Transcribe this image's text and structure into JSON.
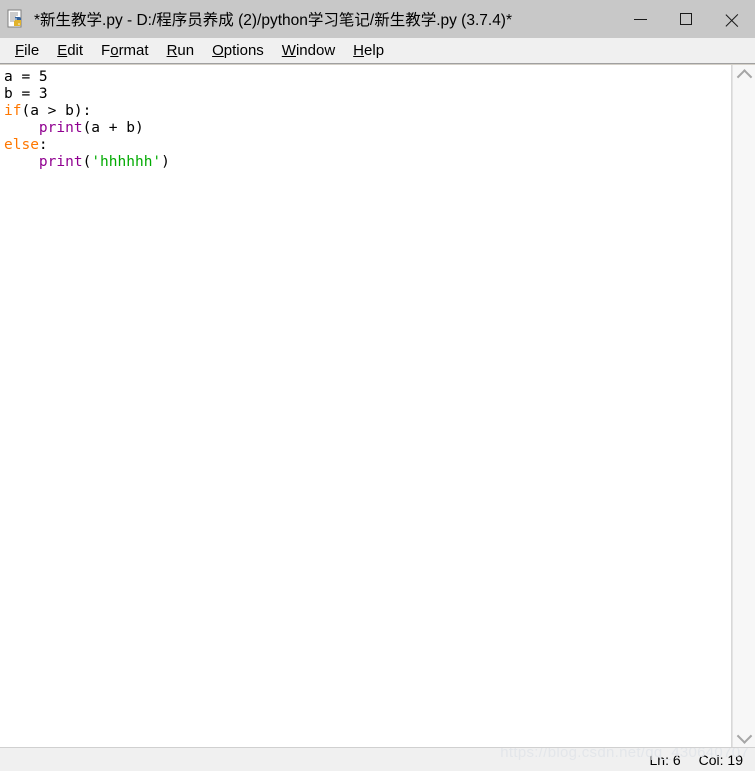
{
  "window": {
    "title": "*新生教学.py - D:/程序员养成 (2)/python学习笔记/新生教学.py (3.7.4)*",
    "icon": "idle-python-file-icon",
    "controls": {
      "minimize": "minimize",
      "maximize": "maximize",
      "close": "close"
    }
  },
  "menubar": {
    "items": [
      {
        "label": "File",
        "accel_index": 0
      },
      {
        "label": "Edit",
        "accel_index": 0
      },
      {
        "label": "Format",
        "accel_index": 1
      },
      {
        "label": "Run",
        "accel_index": 0
      },
      {
        "label": "Options",
        "accel_index": 0
      },
      {
        "label": "Window",
        "accel_index": 0
      },
      {
        "label": "Help",
        "accel_index": 0
      }
    ]
  },
  "editor": {
    "lines": [
      {
        "n": 1,
        "tokens": [
          {
            "t": "a = 5",
            "c": "def"
          }
        ]
      },
      {
        "n": 2,
        "tokens": [
          {
            "t": "b = 3",
            "c": "def"
          }
        ]
      },
      {
        "n": 3,
        "tokens": [
          {
            "t": "if",
            "c": "kw"
          },
          {
            "t": "(a > b):",
            "c": "def"
          }
        ]
      },
      {
        "n": 4,
        "tokens": [
          {
            "t": "    ",
            "c": "def"
          },
          {
            "t": "print",
            "c": "bi"
          },
          {
            "t": "(a + b)",
            "c": "def"
          }
        ]
      },
      {
        "n": 5,
        "tokens": [
          {
            "t": "else",
            "c": "kw"
          },
          {
            "t": ":",
            "c": "def"
          }
        ]
      },
      {
        "n": 6,
        "tokens": [
          {
            "t": "    ",
            "c": "def"
          },
          {
            "t": "print",
            "c": "bi"
          },
          {
            "t": "(",
            "c": "def"
          },
          {
            "t": "'hhhhhh'",
            "c": "str"
          },
          {
            "t": ")",
            "c": "def"
          }
        ]
      }
    ],
    "colors": {
      "keyword": "#ff7700",
      "builtin": "#900090",
      "string": "#00aa00",
      "default": "#000000",
      "background": "#ffffff"
    }
  },
  "scrollbar": {
    "up_arrow": "chevron-up-icon",
    "down_arrow": "chevron-down-icon"
  },
  "statusbar": {
    "line_label": "Ln: 6",
    "col_label": "Col: 19"
  },
  "watermark": {
    "text": "https://blog.csdn.net/qq_430640707"
  }
}
